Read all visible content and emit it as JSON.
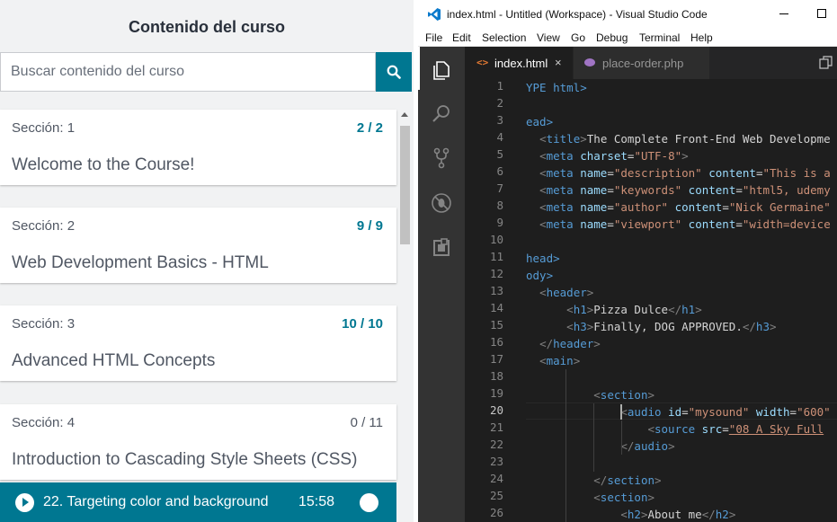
{
  "sidebar": {
    "title": "Contenido del curso",
    "search_placeholder": "Buscar contenido del curso",
    "sections": [
      {
        "label": "Sección: 1",
        "count": "2 / 2",
        "title": "Welcome to the Course!"
      },
      {
        "label": "Sección: 2",
        "count": "9 / 9",
        "title": "Web Development Basics - HTML"
      },
      {
        "label": "Sección: 3",
        "count": "10 / 10",
        "title": "Advanced HTML Concepts"
      },
      {
        "label": "Sección: 4",
        "count": "0 / 11",
        "title": "Introduction to Cascading Style Sheets (CSS)"
      }
    ],
    "now_playing": {
      "title": "22. Targeting color and background",
      "duration": "15:58"
    }
  },
  "vscode": {
    "window_title": "index.html - Untitled (Workspace) - Visual Studio Code",
    "menu": [
      "File",
      "Edit",
      "Selection",
      "View",
      "Go",
      "Debug",
      "Terminal",
      "Help"
    ],
    "tabs": [
      {
        "label": "index.html",
        "icon": "html-file-icon",
        "close": "×"
      },
      {
        "label": "place-order.php",
        "icon": "php-file-icon"
      }
    ],
    "active_line": 20,
    "line_numbers": [
      "1",
      "2",
      "3",
      "4",
      "5",
      "6",
      "7",
      "8",
      "9",
      "10",
      "11",
      "12",
      "13",
      "14",
      "15",
      "16",
      "17",
      "18",
      "19",
      "20",
      "21",
      "22",
      "23",
      "24",
      "25",
      "26"
    ],
    "code_lines": [
      "YPE html>",
      "",
      "ead>",
      "  <title>The Complete Front-End Web Developme",
      "  <meta charset=\"UTF-8\">",
      "  <meta name=\"description\" content=\"This is a",
      "  <meta name=\"keywords\" content=\"html5, udemy",
      "  <meta name=\"author\" content=\"Nick Germaine\"",
      "  <meta name=\"viewport\" content=\"width=device",
      "",
      "head>",
      "ody>",
      "  <header>",
      "      <h1>Pizza Dulce</h1>",
      "      <h3>Finally, DOG APPROVED.</h3>",
      "  </header>",
      "  <main>",
      "",
      "          <section>",
      "              <audio id=\"mysound\" width=\"600\"",
      "                  <source src=\"08 A Sky Full",
      "              </audio>",
      "",
      "          </section>",
      "          <section>",
      "              <h2>About me</h2>"
    ],
    "colors": {
      "tag": "#569cd6",
      "attr": "#9cdcfe",
      "string": "#ce9178",
      "text": "#d4d4d4"
    }
  }
}
